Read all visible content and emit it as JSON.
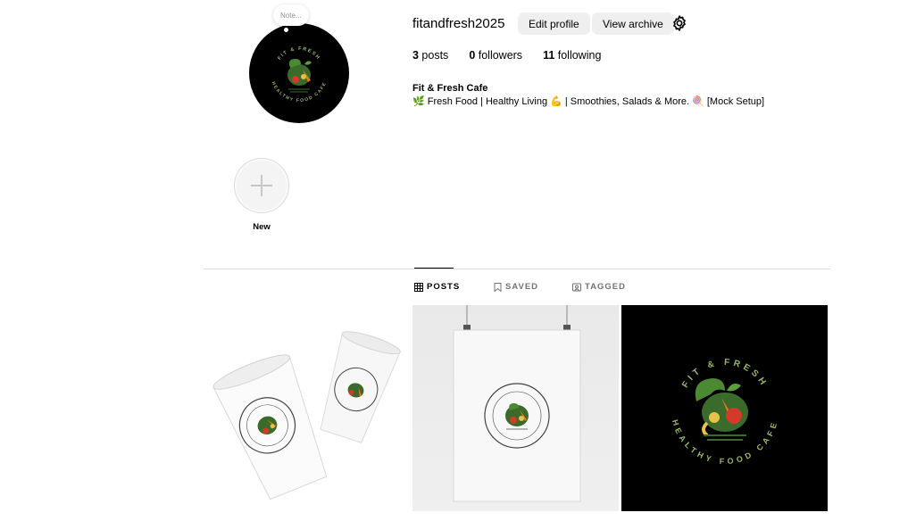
{
  "profile": {
    "username": "fitandfresh2025",
    "note_placeholder": "Note...",
    "edit_profile_label": "Edit profile",
    "view_archive_label": "View archive",
    "stats": {
      "posts_count": "3",
      "posts_label": " posts",
      "followers_count": "0",
      "followers_label": " followers",
      "following_count": "11",
      "following_label": " following"
    },
    "bio_name": "Fit & Fresh Cafe",
    "bio_text": "🌿 Fresh Food | Healthy Living 💪 | Smoothies, Salads & More. 🍭 [Mock Setup]"
  },
  "highlights": {
    "new_label": "New"
  },
  "tabs": {
    "posts": "POSTS",
    "saved": "SAVED",
    "tagged": "TAGGED"
  },
  "logo": {
    "top_text": "FIT & FRESH",
    "bottom_text": "HEALTHY FOOD CAFE"
  },
  "colors": {
    "button_bg": "#efefef",
    "divider": "#dbdbdb",
    "logo_green": "#3a6b2a",
    "logo_text_light": "#9ab86a",
    "carrot": "#e87a1e",
    "tomato": "#d23a2a"
  }
}
